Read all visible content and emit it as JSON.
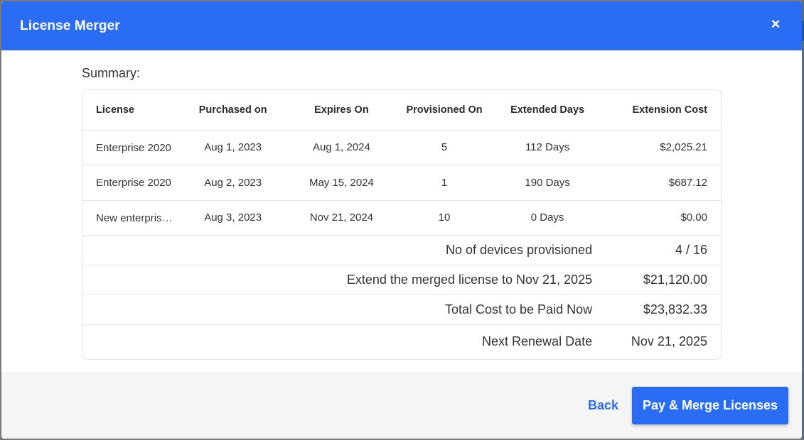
{
  "modal": {
    "title": "License Merger",
    "close_icon": "×"
  },
  "summary": {
    "label": "Summary:",
    "columns": [
      "License",
      "Purchased on",
      "Expires On",
      "Provisioned On",
      "Extended Days",
      "Extension Cost"
    ],
    "rows": [
      {
        "license": "Enterprise 2020",
        "purchased_on": "Aug 1, 2023",
        "expires_on": "Aug 1, 2024",
        "provisioned_on": "5",
        "extended_days": "112 Days",
        "extension_cost": "$2,025.21"
      },
      {
        "license": "Enterprise 2020",
        "purchased_on": "Aug 2, 2023",
        "expires_on": "May 15, 2024",
        "provisioned_on": "1",
        "extended_days": "190 Days",
        "extension_cost": "$687.12"
      },
      {
        "license": "New enterpris…",
        "purchased_on": "Aug 3, 2023",
        "expires_on": "Nov 21, 2024",
        "provisioned_on": "10",
        "extended_days": "0 Days",
        "extension_cost": "$0.00"
      }
    ],
    "totals": [
      {
        "label": "No of devices provisioned",
        "value": "4 / 16"
      },
      {
        "label": "Extend the merged license to Nov 21, 2025",
        "value": "$21,120.00"
      },
      {
        "label": "Total Cost to be Paid Now",
        "value": "$23,832.33"
      },
      {
        "label": "Next Renewal Date",
        "value": "Nov 21, 2025"
      }
    ]
  },
  "footer": {
    "back_label": "Back",
    "pay_label": "Pay & Merge Licenses"
  },
  "colors": {
    "accent": "#2a6df4",
    "footer_bg": "#f5f5f5"
  }
}
